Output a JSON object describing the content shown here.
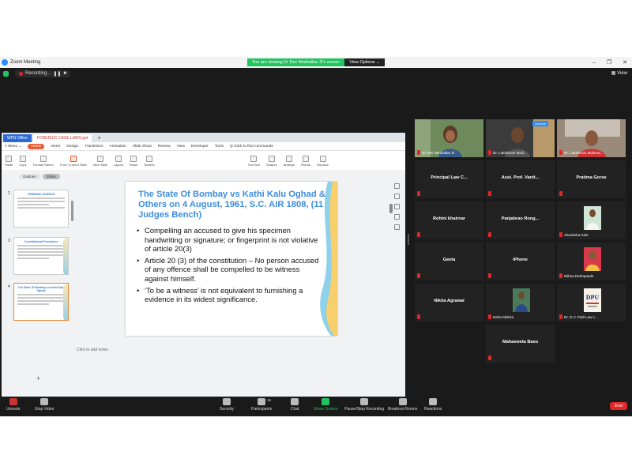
{
  "window": {
    "title": "Zoom Meeting",
    "controls": [
      "–",
      "❐",
      "✕"
    ]
  },
  "share_banner": {
    "text": "You are viewing Dr Dev Nimbalkar 2l's screen",
    "options": "View Options ⌄"
  },
  "recording": {
    "label": "Recording...",
    "pause": "❚❚",
    "stop": "■"
  },
  "view": {
    "label": "View"
  },
  "wps": {
    "tabs": {
      "app": "WPS Office",
      "doc": "FORENSIC CASE LAWS.ppt",
      "plus": "+"
    },
    "menu": [
      "≡ Menu ⌄",
      "Home",
      "Insert",
      "Design",
      "Transitions",
      "Animation",
      "Slide Show",
      "Review",
      "View",
      "Developer",
      "Tools",
      "Q Click to find commands"
    ],
    "ribbon": [
      "Paste",
      "Copy",
      "Format Painter",
      "From Current Slide",
      "New Slide",
      "Layout",
      "Reset",
      "Section",
      "Text Box",
      "Shapes",
      "Arrange",
      "Picture",
      "Replace"
    ],
    "outline_tabs": [
      "Outlines",
      "Slides"
    ],
    "slide_numbers": [
      "2",
      "3",
      "4"
    ],
    "thumb_titles": [
      "FORENSIC SCIENCE",
      "Constitutional Provisions",
      "The State Of Bombay vs Kathi Kalu Oghad"
    ],
    "add_slide": "+",
    "notes": "Click to add notes",
    "status": {
      "slide": "Slide 4 / 16",
      "theme": "Blue Waves",
      "zoom": "75% -"
    }
  },
  "slide": {
    "title": "The State Of Bombay vs Kathi Kalu Oghad & Others on 4 August, 1961, S.C. AIR  1808, (11 Judges  Bench)",
    "bullets": [
      "Compelling an accused to give his specimen handwriting or signature; or fingerprint is not violative of article 20(3)",
      "Article 20 (3) of the constitution – No person accused of any offence shall be compelled to be witness against himself.",
      "‘To be a witness’ is not equivalent to furnishing a evidence in its widest significance."
    ]
  },
  "participants_tiles": [
    {
      "name": "Dr Dev Nimbalkar 2l",
      "type": "video"
    },
    {
      "name": "Dr. Lakshman Bodi...",
      "type": "video",
      "badge": "Unmute"
    },
    {
      "name": "Dr. Lakshman Brahma...",
      "type": "video"
    },
    {
      "name": "Principal  Law  C...",
      "type": "name"
    },
    {
      "name": "Asst. Prof. Vanit...",
      "type": "name"
    },
    {
      "name": "Pratima Gorse",
      "type": "name"
    },
    {
      "name": "Rohini khairnar",
      "type": "name"
    },
    {
      "name": "Panjabrao  Rong...",
      "type": "name"
    },
    {
      "name": "Akanksha Kale",
      "type": "photo"
    },
    {
      "name": "Geeta",
      "type": "name"
    },
    {
      "name": "iPhone",
      "type": "name"
    },
    {
      "name": "Nilima Deshpande",
      "type": "photo"
    },
    {
      "name": "Nikita Agrawal",
      "type": "name"
    },
    {
      "name": "Neha Mishra",
      "type": "photo"
    },
    {
      "name": "Dr. D.Y. Patil Law c...",
      "type": "photo",
      "logo": "DPU"
    },
    {
      "name": "Mahasweta Basu",
      "type": "name"
    }
  ],
  "toolbar": {
    "unmute": "Unmute",
    "stop_video": "Stop Video",
    "security": "Security",
    "participants": "Participants",
    "participants_count": "16",
    "chat": "Chat",
    "share_screen": "Share Screen",
    "pause_recording": "Pause/Stop Recording",
    "breakout": "Breakout Rooms",
    "reactions": "Reactions",
    "end": "End"
  },
  "colors": {
    "accent_green": "#23c35f",
    "zoom_blue": "#2d8cff",
    "end_red": "#e02828",
    "slide_title": "#3c8ce0"
  }
}
